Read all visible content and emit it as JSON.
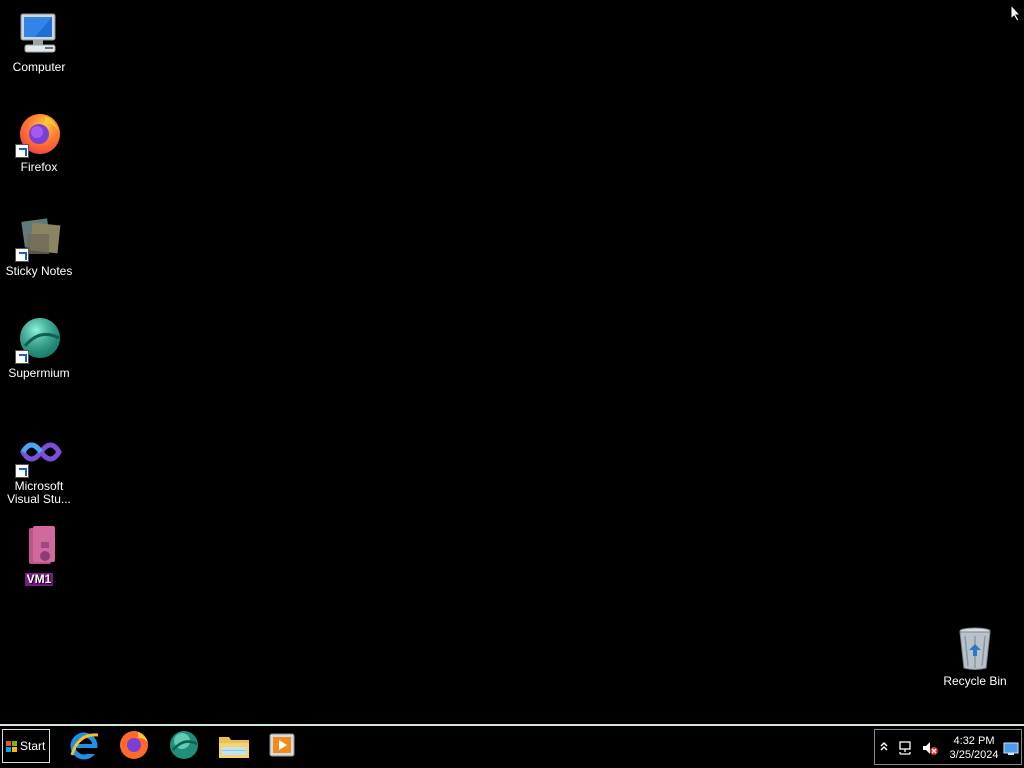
{
  "desktop": {
    "icons": [
      {
        "label": "Computer"
      },
      {
        "label": "Firefox"
      },
      {
        "label": "Sticky Notes"
      },
      {
        "label": "Supermium"
      },
      {
        "label": "Microsoft\nVisual Stu..."
      },
      {
        "label": "VM1"
      }
    ],
    "recycle_bin": {
      "label": "Recycle Bin"
    }
  },
  "taskbar": {
    "start_label": "Start",
    "pinned": [
      "internet-explorer-icon",
      "firefox-icon",
      "supermium-icon",
      "file-explorer-icon",
      "media-player-icon"
    ],
    "clock": {
      "time": "4:32 PM",
      "date": "3/25/2024"
    }
  }
}
